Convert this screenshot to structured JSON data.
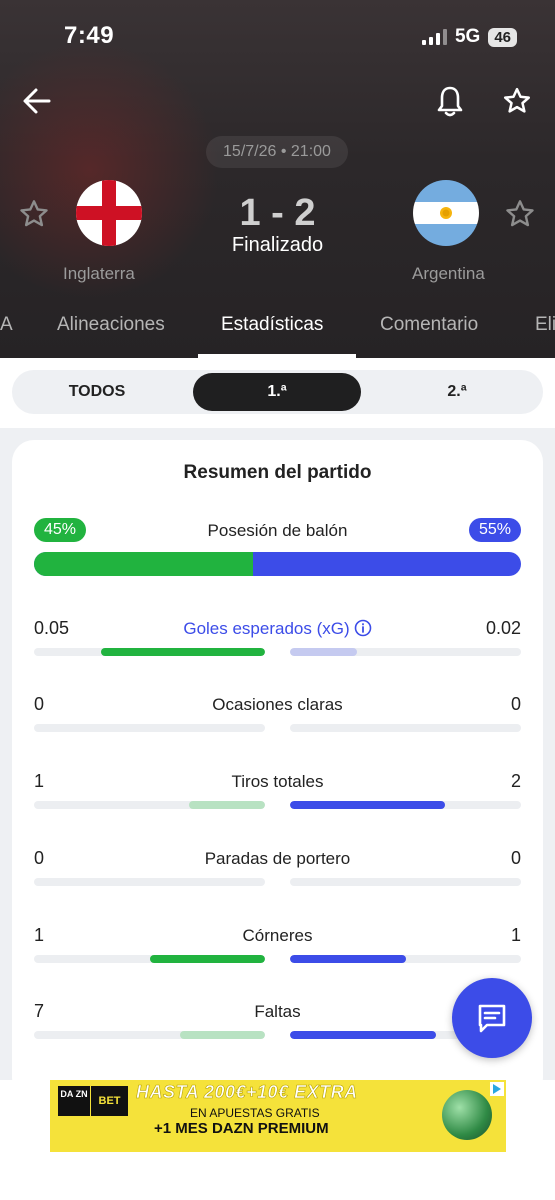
{
  "status_bar": {
    "time": "7:49",
    "network": "5G",
    "battery": "46"
  },
  "match": {
    "datetime": "15/7/26 • 21:00",
    "home": {
      "name": "Inglaterra",
      "flag": "england-flag"
    },
    "away": {
      "name": "Argentina",
      "flag": "argentina-flag"
    },
    "score": "1 - 2",
    "status": "Finalizado"
  },
  "tabs": [
    {
      "label": "A"
    },
    {
      "label": "Alineaciones"
    },
    {
      "label": "Estadísticas",
      "active": true
    },
    {
      "label": "Comentario"
    },
    {
      "label": "Eli"
    }
  ],
  "period_filter": {
    "all": "TODOS",
    "first": "1.ª",
    "second": "2.ª",
    "selected": "first"
  },
  "summary": {
    "title": "Resumen del partido",
    "possession": {
      "label": "Posesión de balón",
      "home_text": "45%",
      "away_text": "55%",
      "home": 45,
      "away": 55
    },
    "stats": [
      {
        "label": "Goles esperados (xG)",
        "home": "0.05",
        "away": "0.02",
        "home_fill": 0.71,
        "away_fill": 0.29,
        "link": true
      },
      {
        "label": "Ocasiones claras",
        "home": "0",
        "away": "0",
        "home_fill": 0,
        "away_fill": 0
      },
      {
        "label": "Tiros totales",
        "home": "1",
        "away": "2",
        "home_fill": 0.33,
        "away_fill": 0.67
      },
      {
        "label": "Paradas de portero",
        "home": "0",
        "away": "0",
        "home_fill": 0,
        "away_fill": 0
      },
      {
        "label": "Córneres",
        "home": "1",
        "away": "1",
        "home_fill": 0.5,
        "away_fill": 0.5
      },
      {
        "label": "Faltas",
        "home": "7",
        "away": "",
        "home_fill": 0.37,
        "away_fill": 0.63
      }
    ]
  },
  "colors": {
    "home": "#21b33f",
    "home_light": "#b8e2c2",
    "away": "#3c4ce8",
    "away_light": "#c5caf0",
    "track": "#eceef1"
  },
  "ad": {
    "brand_top": "DA ZN",
    "brand_bet": "BET",
    "line1": "HASTA 200€+10€ EXTRA",
    "line2": "EN APUESTAS GRATIS",
    "line3": "+1 MES DAZN PREMIUM"
  }
}
